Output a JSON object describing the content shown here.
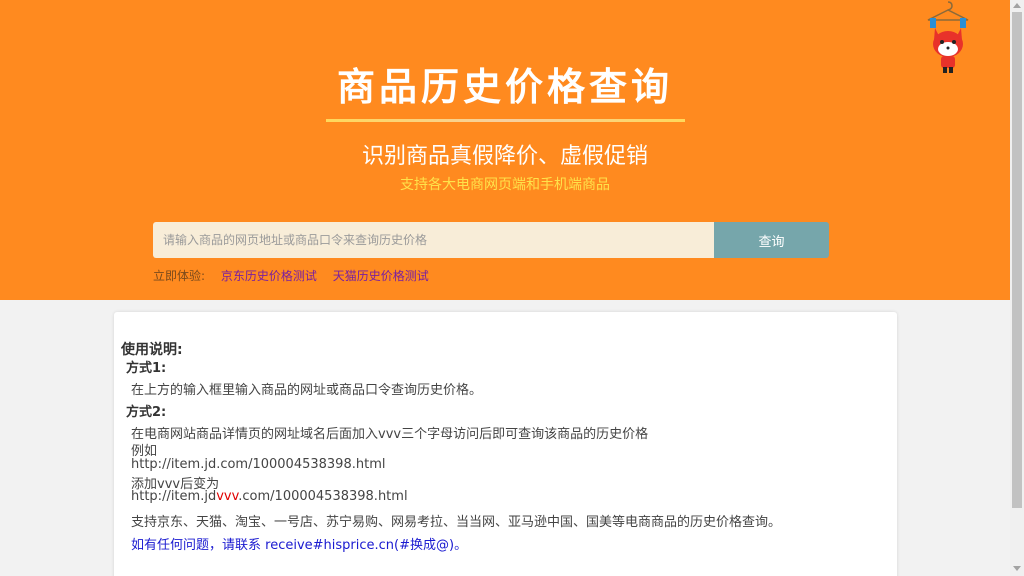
{
  "header": {
    "title": "商品历史价格查询",
    "subtitle": "识别商品真假降价、虚假促销",
    "tagline": "支持各大电商网页端和手机端商品"
  },
  "search": {
    "placeholder": "请输入商品的网页地址或商品口令来查询历史价格",
    "value": "",
    "button_label": "查询"
  },
  "try": {
    "label": "立即体验:",
    "links": [
      "京东历史价格测试",
      "天猫历史价格测试"
    ]
  },
  "instructions": {
    "heading": "使用说明:",
    "method1_label": "方式1:",
    "method1_text": "在上方的输入框里输入商品的网址或商品口令查询历史价格。",
    "method2_label": "方式2:",
    "method2_text": "在电商网站商品详情页的网址域名后面加入vvv三个字母访问后即可查询该商品的历史价格",
    "example_label": "例如",
    "example_url": "http://item.jd.com/100004538398.html",
    "after_label": "添加vvv后变为",
    "after_url_prefix": "http://item.jd",
    "after_url_highlight": "vvv",
    "after_url_suffix": ".com/100004538398.html",
    "supported": "支持京东、天猫、淘宝、一号店、苏宁易购、网易考拉、当当网、亚马逊中国、国美等电商商品的历史价格查询。",
    "contact": "如有任何问题，请联系 receive#hisprice.cn(#换成@)。"
  },
  "colors": {
    "header_bg": "#ff8a1f",
    "tagline": "#ffe24a",
    "search_button": "#76a6ab",
    "highlight": "#e00000",
    "contact": "#1a1ad0",
    "try_link": "#7a1fa0"
  },
  "icons": {
    "mascot": "fox-mascot-on-hanger-icon"
  }
}
